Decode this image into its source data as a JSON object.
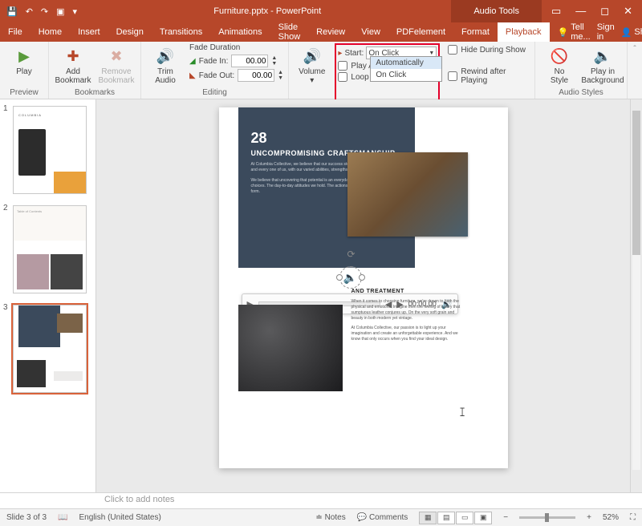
{
  "titlebar": {
    "title": "Furniture.pptx - PowerPoint",
    "audio_tools": "Audio Tools"
  },
  "tabs": {
    "file": "File",
    "home": "Home",
    "insert": "Insert",
    "design": "Design",
    "transitions": "Transitions",
    "animations": "Animations",
    "slideshow": "Slide Show",
    "review": "Review",
    "view": "View",
    "pdfelement": "PDFelement",
    "format": "Format",
    "playback": "Playback",
    "tell_me": "Tell me...",
    "sign_in": "Sign in",
    "share": "Share"
  },
  "ribbon": {
    "preview": {
      "play": "Play",
      "group": "Preview"
    },
    "bookmarks": {
      "add": "Add\nBookmark",
      "remove": "Remove\nBookmark",
      "group": "Bookmarks"
    },
    "editing": {
      "trim": "Trim\nAudio",
      "fade_duration": "Fade Duration",
      "fade_in": "Fade In:",
      "fade_in_val": "00.00",
      "fade_out": "Fade Out:",
      "fade_out_val": "00.00",
      "group": "Editing"
    },
    "audio_options": {
      "volume": "Volume",
      "start": "Start:",
      "start_value": "On Click",
      "dropdown": {
        "automatically": "Automatically",
        "on_click": "On Click"
      },
      "play_across": "Play A",
      "loop": "Loop",
      "hide": "Hide During Show",
      "rewind": "Rewind after Playing",
      "group": "Audio Options"
    },
    "audio_styles": {
      "no_style": "No\nStyle",
      "play_bg": "Play in\nBackground",
      "group": "Audio Styles"
    }
  },
  "thumbs": {
    "n1": "1",
    "n2": "2",
    "n3": "3",
    "t1_brand": "COLUMBIA",
    "t2_toc": "Table of Contents"
  },
  "slide": {
    "num": "28",
    "title": "UNCOMPROMISING CRAFTSMANSHIP",
    "p1": "At Columbia Collective, we believe that our success stems from our people. Each and every one of us, with our varied abilities, strengths and potential.",
    "p2": "We believe that uncovering that potential is an everyday process. A journey of choices. The day-to-day attitudes we hold. The actions we take and the habits we form.",
    "right_title": "AND TREATMENT",
    "rp1": "When it comes to choosing furniture, we're drawn to both the physical and emotions. Imagine then the feeling of luxury that sumptuous leather conjures up. On the very soft grain and beauty in both modern yet vintage.",
    "rp2": "At Columbia Collective, our passion is to light up your imagination and create an unforgettable experience. And we know that only occurs when you find your ideal design.",
    "media_time": "00:00.00"
  },
  "notes": {
    "placeholder": "Click to add notes"
  },
  "status": {
    "slide": "Slide 3 of 3",
    "lang": "English (United States)",
    "notes": "Notes",
    "comments": "Comments",
    "zoom": "52%"
  }
}
